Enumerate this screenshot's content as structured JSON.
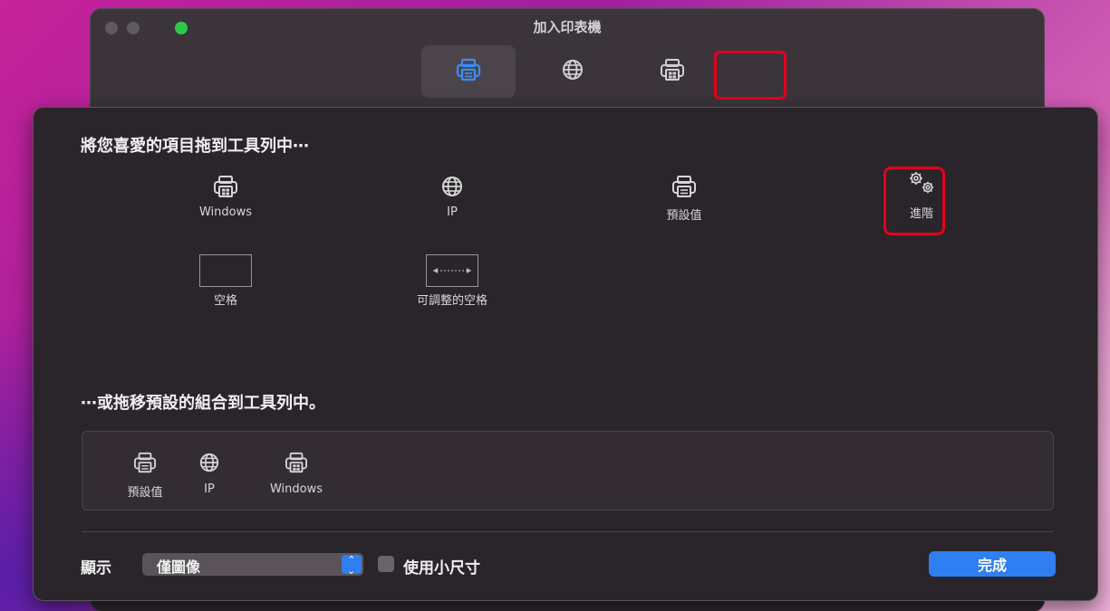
{
  "window": {
    "title": "加入印表機"
  },
  "toolbar": {
    "items": [
      {
        "name": "default",
        "icon": "printer-icon",
        "selected": true
      },
      {
        "name": "ip",
        "icon": "globe-icon",
        "selected": false
      },
      {
        "name": "windows",
        "icon": "printer-windows-icon",
        "selected": false
      }
    ]
  },
  "sheet": {
    "drag_heading": "將您喜愛的項目拖到工具列中⋯",
    "palette": {
      "windows": "Windows",
      "ip": "IP",
      "default": "預設值",
      "advanced": "進階",
      "space": "空格",
      "flexible_space": "可調整的空格"
    },
    "default_set_heading": "⋯或拖移預設的組合到工具列中。",
    "default_set": {
      "default": "預設值",
      "ip": "IP",
      "windows": "Windows"
    },
    "show_label": "顯示",
    "show_value": "僅圖像",
    "small_size_label": "使用小尺寸",
    "small_size_checked": false,
    "done": "完成"
  },
  "colors": {
    "accent": "#2f7ff2",
    "highlight": "#e4001b",
    "zoom_button": "#2ec94a"
  }
}
